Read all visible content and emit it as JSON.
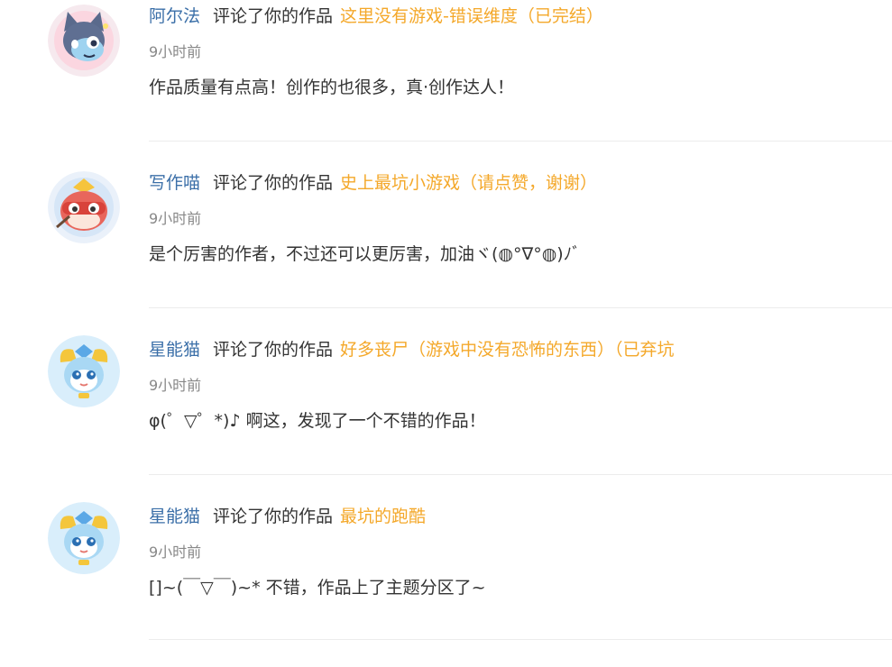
{
  "notifications": [
    {
      "avatar_icon": "wolf-cat-avatar",
      "username": "阿尔法",
      "action": "评论了你的作品",
      "work_title": "这里没有游戏-错误维度（已完结）",
      "time": "9小时前",
      "content": "作品质量有点高！创作的也很多，真·创作达人！"
    },
    {
      "avatar_icon": "red-mask-cat-avatar",
      "username": "写作喵",
      "action": "评论了你的作品",
      "work_title": "史上最坑小游戏（请点赞，谢谢）",
      "time": "9小时前",
      "content": "是个厉害的作者，不过还可以更厉害，加油ヾ(◍°∇°◍)ﾉﾞ"
    },
    {
      "avatar_icon": "blue-cat-avatar",
      "username": "星能猫",
      "action": "评论了你的作品",
      "work_title": "好多丧尸（游戏中没有恐怖的东西）（已弃坑",
      "time": "9小时前",
      "content": "φ(゜▽゜*)♪ 啊这，发现了一个不错的作品！"
    },
    {
      "avatar_icon": "blue-cat-avatar",
      "username": "星能猫",
      "action": "评论了你的作品",
      "work_title": "最坑的跑酷",
      "time": "9小时前",
      "content": "[]~(￣▽￣)~* 不错，作品上了主题分区了~"
    }
  ],
  "colors": {
    "username": "#3b6fa8",
    "work_title": "#f4a82a",
    "time": "#888888",
    "text": "#333333",
    "divider": "#ececec"
  }
}
